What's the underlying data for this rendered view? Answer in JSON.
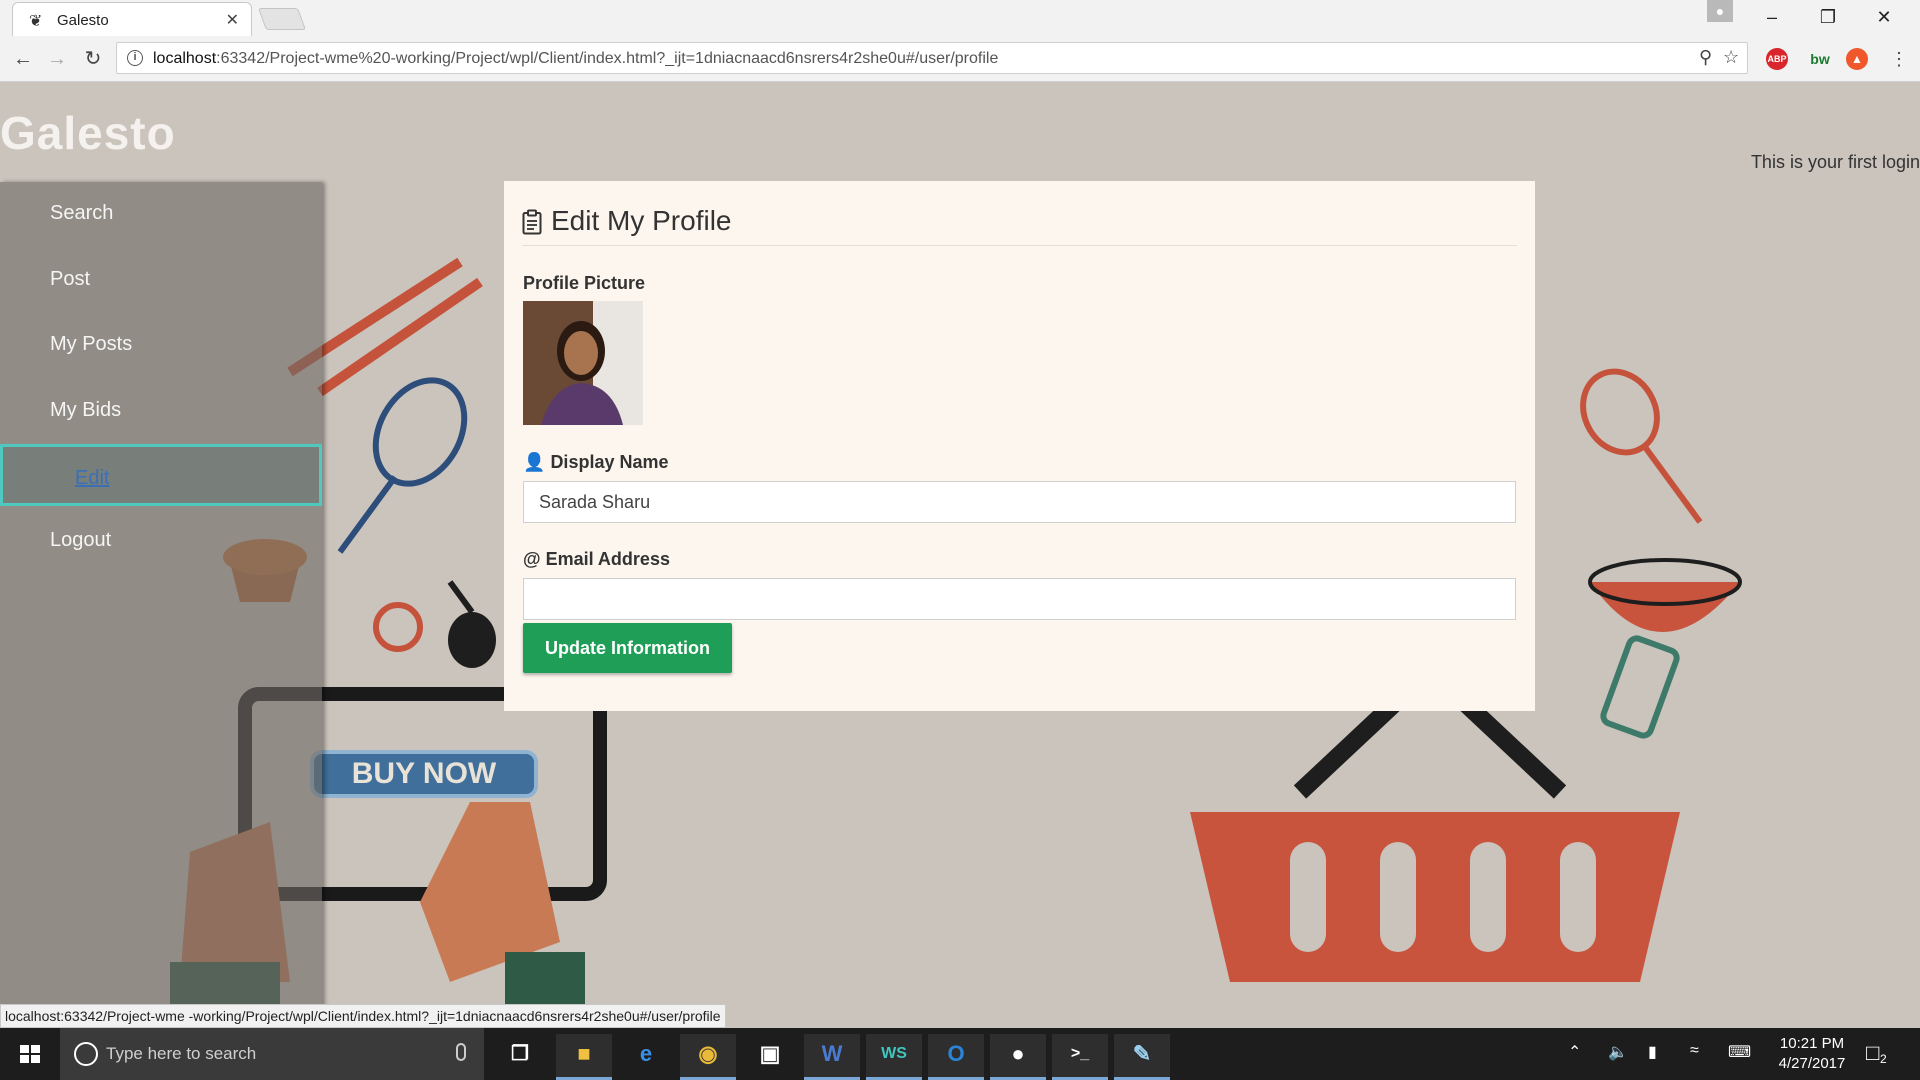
{
  "browser": {
    "tab_title": "Galesto",
    "url_host": "localhost",
    "url_rest": ":63342/Project-wme%20-working/Project/wpl/Client/index.html?_ijt=1dniacnaacd6nsrers4r2she0u#/user/profile",
    "status_url": "localhost:63342/Project-wme -working/Project/wpl/Client/index.html?_ijt=1dniacnaacd6nsrers4r2she0u#/user/profile",
    "ext_abp": "ABP",
    "ext_bw": "bw"
  },
  "site": {
    "brand": "Galesto",
    "first_login_text": "This is your first login"
  },
  "sidebar": {
    "items": [
      {
        "label": "Search"
      },
      {
        "label": "Post"
      },
      {
        "label": "My Posts"
      },
      {
        "label": "My Bids"
      },
      {
        "label": "Edit"
      },
      {
        "label": "Logout"
      }
    ]
  },
  "background": {
    "buy_now": "BUY NOW"
  },
  "profile_form": {
    "title": "Edit My Profile",
    "picture_label": "Profile Picture",
    "display_name_label": "Display Name",
    "display_name_value": "Sarada Sharu",
    "email_label": "Email Address",
    "email_value": "",
    "submit_label": "Update Information"
  },
  "taskbar": {
    "search_placeholder": "Type here to search",
    "time": "10:21 PM",
    "date": "4/27/2017",
    "notification_count": "2"
  }
}
